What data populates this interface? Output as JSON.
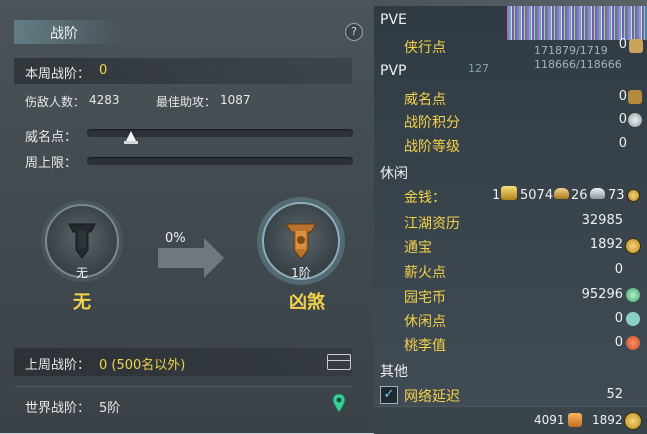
{
  "left": {
    "title": "战阶",
    "help": "?",
    "weekly_rank_label": "本周战阶：",
    "weekly_rank_value": "0",
    "kills_label": "伤敌人数：",
    "kills_value": "4283",
    "assist_label": "最佳助攻：",
    "assist_value": "1087",
    "prestige_label": "威名点：",
    "weekly_cap_label": "周上限：",
    "current_rank_level": "无",
    "current_rank_name": "无",
    "progress_percent": "0%",
    "next_rank_level": "1阶",
    "next_rank_name": "凶煞",
    "last_week_label": "上周战阶：",
    "last_week_value": "0 (500名以外)",
    "world_rank_label": "世界战阶：",
    "world_rank_value": "5阶",
    "prestige_fill": 0.16
  },
  "right": {
    "pve_header": "PVE",
    "pve_items": [
      {
        "label": "侠行点",
        "value": "0"
      }
    ],
    "pvp_header": "PVP",
    "pvp_items": [
      {
        "label": "威名点",
        "value": "0"
      },
      {
        "label": "战阶积分",
        "value": "0"
      },
      {
        "label": "战阶等级",
        "value": "0"
      }
    ],
    "leisure_header": "休闲",
    "money_label": "金钱：",
    "money_gold": "1",
    "money_silver": "5074",
    "money_copper": "26",
    "money_iron": "73",
    "leisure_items": [
      {
        "label": "江湖资历",
        "value": "32985"
      },
      {
        "label": "通宝",
        "value": "1892"
      },
      {
        "label": "薪火点",
        "value": "0"
      },
      {
        "label": "园宅币",
        "value": "95296"
      },
      {
        "label": "休闲点",
        "value": "0"
      },
      {
        "label": "桃李值",
        "value": "0"
      }
    ],
    "other_header": "其他",
    "latency_label": "网络延迟",
    "latency_value": "52",
    "bottom_left_value": "4091",
    "bottom_right_value": "1892",
    "overlay_hp1": "171879/1719",
    "overlay_hp2": "118666/118666",
    "overlay_level": "127"
  }
}
